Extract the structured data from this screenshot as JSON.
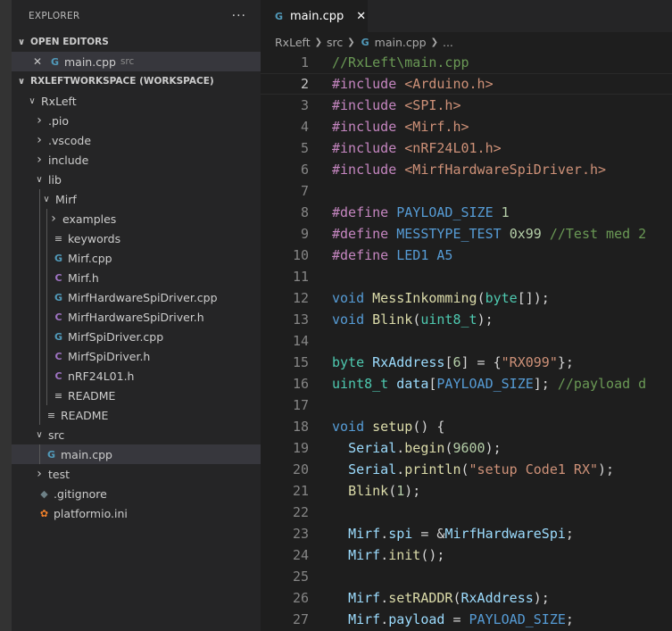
{
  "explorer": {
    "title": "EXPLORER",
    "more": "···",
    "open_editors_label": "OPEN EDITORS",
    "open_editor": {
      "name": "main.cpp",
      "desc": "src"
    },
    "workspace_label": "RXLEFTWORKSPACE (WORKSPACE)",
    "tree": [
      {
        "label": "RxLeft",
        "depth": 0,
        "kind": "folder-open"
      },
      {
        "label": ".pio",
        "depth": 1,
        "kind": "folder"
      },
      {
        "label": ".vscode",
        "depth": 1,
        "kind": "folder"
      },
      {
        "label": "include",
        "depth": 1,
        "kind": "folder"
      },
      {
        "label": "lib",
        "depth": 1,
        "kind": "folder-open"
      },
      {
        "label": "Mirf",
        "depth": 2,
        "kind": "folder-open"
      },
      {
        "label": "examples",
        "depth": 3,
        "kind": "folder"
      },
      {
        "label": "keywords",
        "depth": 3,
        "kind": "txt"
      },
      {
        "label": "Mirf.cpp",
        "depth": 3,
        "kind": "cpp"
      },
      {
        "label": "Mirf.h",
        "depth": 3,
        "kind": "h"
      },
      {
        "label": "MirfHardwareSpiDriver.cpp",
        "depth": 3,
        "kind": "cpp"
      },
      {
        "label": "MirfHardwareSpiDriver.h",
        "depth": 3,
        "kind": "h"
      },
      {
        "label": "MirfSpiDriver.cpp",
        "depth": 3,
        "kind": "cpp"
      },
      {
        "label": "MirfSpiDriver.h",
        "depth": 3,
        "kind": "h"
      },
      {
        "label": "nRF24L01.h",
        "depth": 3,
        "kind": "h"
      },
      {
        "label": "README",
        "depth": 3,
        "kind": "txt"
      },
      {
        "label": "README",
        "depth": 2,
        "kind": "txt"
      },
      {
        "label": "src",
        "depth": 1,
        "kind": "folder-open"
      },
      {
        "label": "main.cpp",
        "depth": 2,
        "kind": "cpp",
        "selected": true
      },
      {
        "label": "test",
        "depth": 1,
        "kind": "folder"
      },
      {
        "label": ".gitignore",
        "depth": 1,
        "kind": "git"
      },
      {
        "label": "platformio.ini",
        "depth": 1,
        "kind": "pio"
      }
    ]
  },
  "icons": {
    "cpp": "file-cpp-icon",
    "h": "file-header-icon",
    "txt": "file-text-icon",
    "git": "git-icon",
    "pio": "platformio-icon"
  },
  "editor": {
    "tab_label": "main.cpp",
    "tab_close": "✕",
    "breadcrumb": [
      "RxLeft",
      "src",
      "main.cpp",
      "..."
    ],
    "current_line": 2,
    "lines": [
      [
        [
          "//RxLeft\\main.cpp",
          "com"
        ]
      ],
      [
        [
          "#include",
          "kw"
        ],
        [
          " ",
          ""
        ],
        [
          "<Arduino.h>",
          "str"
        ]
      ],
      [
        [
          "#include",
          "kw"
        ],
        [
          " ",
          ""
        ],
        [
          "<SPI.h>",
          "str"
        ]
      ],
      [
        [
          "#include",
          "kw"
        ],
        [
          " ",
          ""
        ],
        [
          "<Mirf.h>",
          "str"
        ]
      ],
      [
        [
          "#include",
          "kw"
        ],
        [
          " ",
          ""
        ],
        [
          "<nRF24L01.h>",
          "str"
        ]
      ],
      [
        [
          "#include",
          "kw"
        ],
        [
          " ",
          ""
        ],
        [
          "<MirfHardwareSpiDriver.h>",
          "str"
        ]
      ],
      [],
      [
        [
          "#define",
          "kw"
        ],
        [
          " ",
          ""
        ],
        [
          "PAYLOAD_SIZE",
          "mac"
        ],
        [
          " ",
          ""
        ],
        [
          "1",
          "num"
        ]
      ],
      [
        [
          "#define",
          "kw"
        ],
        [
          " ",
          ""
        ],
        [
          "MESSTYPE_TEST",
          "mac"
        ],
        [
          " ",
          ""
        ],
        [
          "0x99",
          "num"
        ],
        [
          " ",
          ""
        ],
        [
          "//Test med 2",
          "com"
        ]
      ],
      [
        [
          "#define",
          "kw"
        ],
        [
          " ",
          ""
        ],
        [
          "LED1",
          "mac"
        ],
        [
          " ",
          ""
        ],
        [
          "A5",
          "mac"
        ]
      ],
      [],
      [
        [
          "void",
          "typekw"
        ],
        [
          " ",
          ""
        ],
        [
          "MessInkomming",
          "fn"
        ],
        [
          "(",
          ""
        ],
        [
          "byte",
          "type"
        ],
        [
          "[]);",
          ""
        ]
      ],
      [
        [
          "void",
          "typekw"
        ],
        [
          " ",
          ""
        ],
        [
          "Blink",
          "fn"
        ],
        [
          "(",
          ""
        ],
        [
          "uint8_t",
          "type"
        ],
        [
          ");",
          ""
        ]
      ],
      [],
      [
        [
          "byte",
          "type"
        ],
        [
          " ",
          ""
        ],
        [
          "RxAddress",
          "var"
        ],
        [
          "[",
          ""
        ],
        [
          "6",
          "num"
        ],
        [
          "] = {",
          ""
        ],
        [
          "\"RX099\"",
          "str"
        ],
        [
          "};",
          ""
        ]
      ],
      [
        [
          "uint8_t",
          "type"
        ],
        [
          " ",
          ""
        ],
        [
          "data",
          "var"
        ],
        [
          "[",
          ""
        ],
        [
          "PAYLOAD_SIZE",
          "mac"
        ],
        [
          "]; ",
          ""
        ],
        [
          "//payload d",
          "com"
        ]
      ],
      [],
      [
        [
          "void",
          "typekw"
        ],
        [
          " ",
          ""
        ],
        [
          "setup",
          "fn"
        ],
        [
          "() {",
          ""
        ]
      ],
      [
        [
          "  ",
          ""
        ],
        [
          "Serial",
          "var"
        ],
        [
          ".",
          ""
        ],
        [
          "begin",
          "fn"
        ],
        [
          "(",
          ""
        ],
        [
          "9600",
          "num"
        ],
        [
          ");",
          ""
        ]
      ],
      [
        [
          "  ",
          ""
        ],
        [
          "Serial",
          "var"
        ],
        [
          ".",
          ""
        ],
        [
          "println",
          "fn"
        ],
        [
          "(",
          ""
        ],
        [
          "\"setup Code1 RX\"",
          "str"
        ],
        [
          ");",
          ""
        ]
      ],
      [
        [
          "  ",
          ""
        ],
        [
          "Blink",
          "fn"
        ],
        [
          "(",
          ""
        ],
        [
          "1",
          "num"
        ],
        [
          ");",
          ""
        ]
      ],
      [],
      [
        [
          "  ",
          ""
        ],
        [
          "Mirf",
          "var"
        ],
        [
          ".",
          ""
        ],
        [
          "spi",
          "var"
        ],
        [
          " = &",
          ""
        ],
        [
          "MirfHardwareSpi",
          "var"
        ],
        [
          ";",
          ""
        ]
      ],
      [
        [
          "  ",
          ""
        ],
        [
          "Mirf",
          "var"
        ],
        [
          ".",
          ""
        ],
        [
          "init",
          "fn"
        ],
        [
          "();",
          ""
        ]
      ],
      [],
      [
        [
          "  ",
          ""
        ],
        [
          "Mirf",
          "var"
        ],
        [
          ".",
          ""
        ],
        [
          "setRADDR",
          "fn"
        ],
        [
          "(",
          ""
        ],
        [
          "RxAddress",
          "var"
        ],
        [
          ");",
          ""
        ]
      ],
      [
        [
          "  ",
          ""
        ],
        [
          "Mirf",
          "var"
        ],
        [
          ".",
          ""
        ],
        [
          "payload",
          "var"
        ],
        [
          " = ",
          ""
        ],
        [
          "PAYLOAD_SIZE",
          "mac"
        ],
        [
          ";",
          ""
        ]
      ]
    ]
  }
}
